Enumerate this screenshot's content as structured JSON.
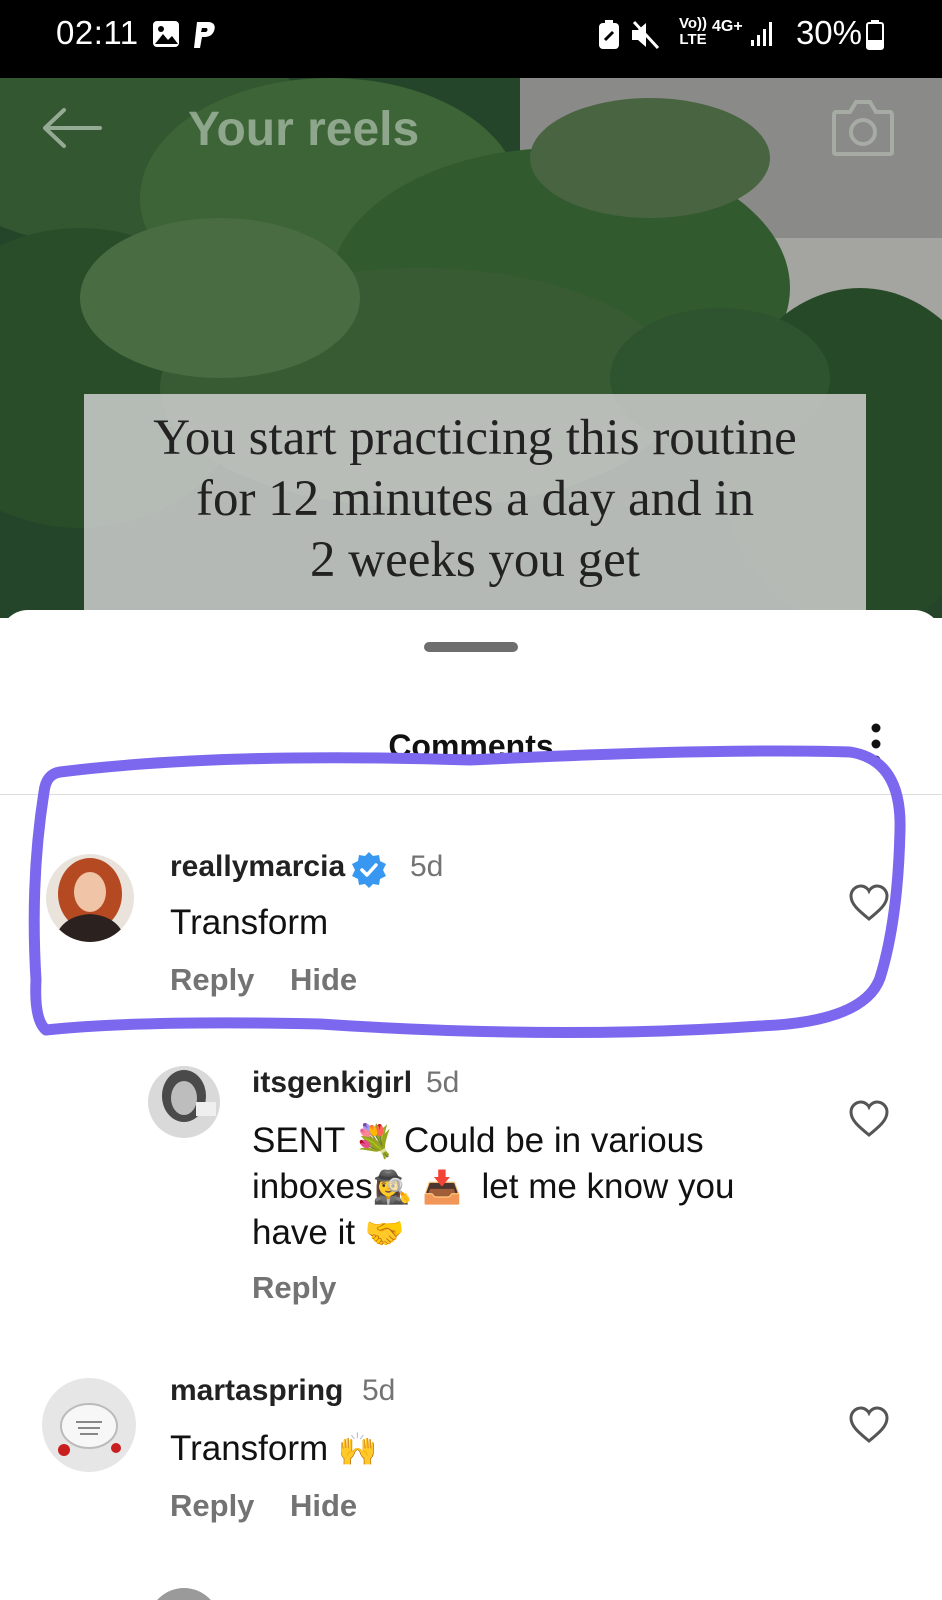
{
  "status_bar": {
    "time": "02:11",
    "battery": "30%",
    "network": "4G+",
    "volte": "Vo)) LTE"
  },
  "header": {
    "title": "Your reels"
  },
  "video": {
    "caption_lines": [
      "You start practicing this routine",
      "for 12 minutes a day and in",
      "2 weeks you get"
    ]
  },
  "comments_sheet": {
    "title": "Comments",
    "comments": [
      {
        "username": "reallymarcia",
        "verified": true,
        "time": "5d",
        "text": "Transform",
        "actions": [
          "Reply",
          "Hide"
        ]
      },
      {
        "username": "itsgenkigirl",
        "time": "5d",
        "text_parts": [
          "SENT",
          "💐",
          "Could be in various",
          "inboxes",
          "🕵️‍♀️",
          "📥",
          "let me know you",
          "have it",
          "🤝"
        ],
        "actions": [
          "Reply"
        ]
      },
      {
        "username": "martaspring",
        "time": "5d",
        "text": "Transform",
        "emoji": "🙌",
        "actions": [
          "Reply",
          "Hide"
        ]
      }
    ]
  },
  "colors": {
    "annotation_outline": "#7b68ee",
    "verified_badge": "#3897f0"
  }
}
